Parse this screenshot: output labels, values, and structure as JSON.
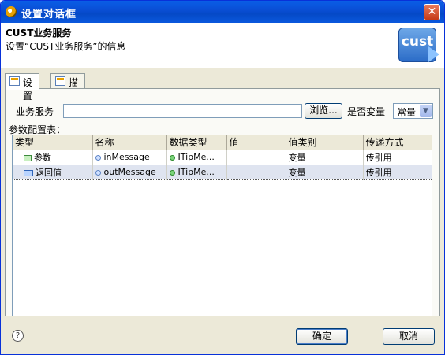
{
  "window": {
    "title": "设置对话框",
    "close_label": "✕"
  },
  "header": {
    "title": "CUST业务服务",
    "description": "设置“CUST业务服务”的信息",
    "logo_text": "cust"
  },
  "tabs": [
    {
      "label": "设置",
      "active": true
    },
    {
      "label": "描述",
      "active": false
    }
  ],
  "form": {
    "service_label": "业务服务",
    "service_value": "",
    "browse_label": "浏览...",
    "is_variable_label": "是否变量",
    "is_variable_value": "常量"
  },
  "params": {
    "label": "参数配置表：",
    "columns": [
      "类型",
      "名称",
      "数据类型",
      "值",
      "值类别",
      "传递方式"
    ],
    "rows": [
      {
        "type": "参数",
        "name": "inMessage",
        "datatype": "ITipMe...",
        "value": "",
        "value_category": "变量",
        "pass_mode": "传引用"
      },
      {
        "type": "返回值",
        "name": "outMessage",
        "datatype": "ITipMe...",
        "value": "",
        "value_category": "变量",
        "pass_mode": "传引用"
      }
    ]
  },
  "footer": {
    "help_label": "?",
    "ok_label": "确定",
    "cancel_label": "取消"
  },
  "colors": {
    "titlebar": "#0a4fd6",
    "selection": "#dfe4f0",
    "dialog_bg": "#ece9d8"
  }
}
